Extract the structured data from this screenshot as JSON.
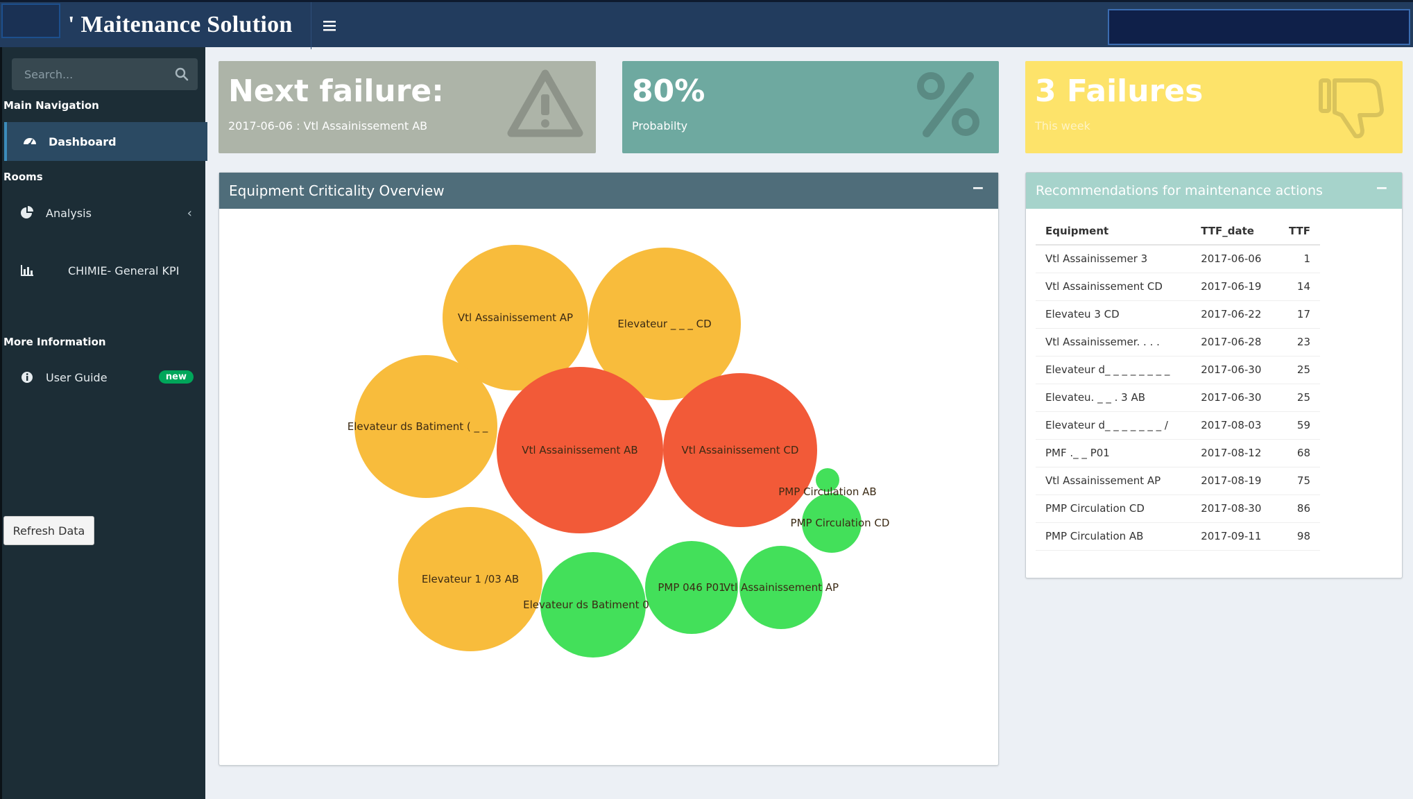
{
  "header": {
    "brand": "' Maitenance Solution",
    "menu_icon": "hamburger-icon"
  },
  "sidebar": {
    "search": {
      "placeholder": "Search...",
      "icon": "search-icon"
    },
    "sections": {
      "main": "Main Navigation",
      "rooms": "Rooms",
      "more": "More Information"
    },
    "items": [
      {
        "label": "Dashboard",
        "icon": "dashboard-icon",
        "active": true
      },
      {
        "label": "Analysis",
        "icon": "pie-chart-icon"
      },
      {
        "label": "CHIMIE- General KPI",
        "icon": "bar-chart-icon"
      },
      {
        "label": "User Guide",
        "icon": "info-icon",
        "badge": "new"
      }
    ],
    "refresh_label": "Refresh Data"
  },
  "infoboxes": [
    {
      "value": "Next failure:",
      "sub": "2017-06-06 : Vtl Assainissement AB",
      "color": "#adb4a8",
      "icon": "warning-icon"
    },
    {
      "value": "80%",
      "sub": "Probabilty",
      "color": "#6ea9a0",
      "icon": "percent-icon"
    },
    {
      "value": "3 Failures",
      "sub": "This week",
      "color": "#fde36a",
      "icon": "thumbs-down-icon"
    }
  ],
  "criticality": {
    "title": "Equipment Criticality Overview",
    "collapse": "−",
    "colors": {
      "high": "#f25a38",
      "medium": "#f8bc3c",
      "low": "#43e05a"
    },
    "bubbles": [
      {
        "label": "Vtl Assainissement AP",
        "level": "medium"
      },
      {
        "label": "Elevateur _ _ _ CD",
        "level": "medium"
      },
      {
        "label": "Elevateur ds Batiment ( _ _",
        "level": "medium"
      },
      {
        "label": "Vtl Assainissement AB",
        "level": "high"
      },
      {
        "label": "Vtl Assainissement CD",
        "level": "high"
      },
      {
        "label": "PMP Circulation AB",
        "level": "low"
      },
      {
        "label": "PMP Circulation CD",
        "level": "low"
      },
      {
        "label": "Elevateur 1 /03 AB",
        "level": "medium"
      },
      {
        "label": "Elevateur ds Batiment 0",
        "level": "low"
      },
      {
        "label": "PMP 046 P01",
        "level": "low"
      },
      {
        "label": "Vtl Assainissement AP",
        "level": "low"
      }
    ]
  },
  "recommendations": {
    "title": "Recommendations for maintenance actions",
    "collapse": "−",
    "header_color": "#a6d3cb",
    "columns": [
      "Equipment",
      "TTF_date",
      "TTF"
    ],
    "rows": [
      [
        "Vtl Assainissemer     3",
        "2017-06-06",
        "1"
      ],
      [
        "Vtl Assainissement CD",
        "2017-06-19",
        "14"
      ],
      [
        "Elevateu       3 CD",
        "2017-06-22",
        "17"
      ],
      [
        "Vtl Assainissemer. . . .",
        "2017-06-28",
        "23"
      ],
      [
        "Elevateur d_ _ _ _ _ _ _ _",
        "2017-06-30",
        "25"
      ],
      [
        "Elevateu. _ _ . 3 AB",
        "2017-06-30",
        "25"
      ],
      [
        "Elevateur d_ _ _ _ _ _ _ /",
        "2017-08-03",
        "59"
      ],
      [
        "PMF ._ _ P01",
        "2017-08-12",
        "68"
      ],
      [
        "Vtl Assainissement AP",
        "2017-08-19",
        "75"
      ],
      [
        "PMP Circulation CD",
        "2017-08-30",
        "86"
      ],
      [
        "PMP Circulation AB",
        "2017-09-11",
        "98"
      ]
    ]
  }
}
